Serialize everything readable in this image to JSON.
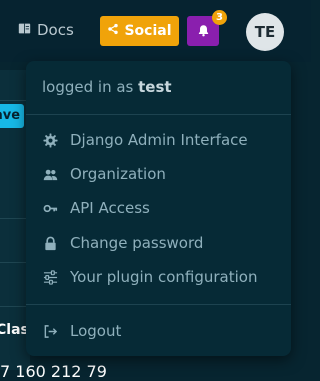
{
  "topbar": {
    "docs_label": "Docs",
    "social_label": "Social",
    "notification_count": "3",
    "avatar_initials": "TE"
  },
  "background": {
    "button_fragment": "ave",
    "heading_fragment": "Clas",
    "number_fragment": "7 160 212 79"
  },
  "dropdown": {
    "login_prefix": "logged in as",
    "username": "test",
    "items": [
      {
        "label": "Django Admin Interface",
        "icon": "gear-icon"
      },
      {
        "label": "Organization",
        "icon": "users-icon"
      },
      {
        "label": "API Access",
        "icon": "key-icon"
      },
      {
        "label": "Change password",
        "icon": "lock-icon"
      },
      {
        "label": "Your plugin configuration",
        "icon": "sliders-icon"
      }
    ],
    "logout": {
      "label": "Logout",
      "icon": "logout-icon"
    }
  },
  "colors": {
    "background": "#072530",
    "dropdown_bg": "#062a36",
    "social": "#f0a30a",
    "notification": "#8a1fae",
    "text_muted": "#8fb0bc"
  }
}
